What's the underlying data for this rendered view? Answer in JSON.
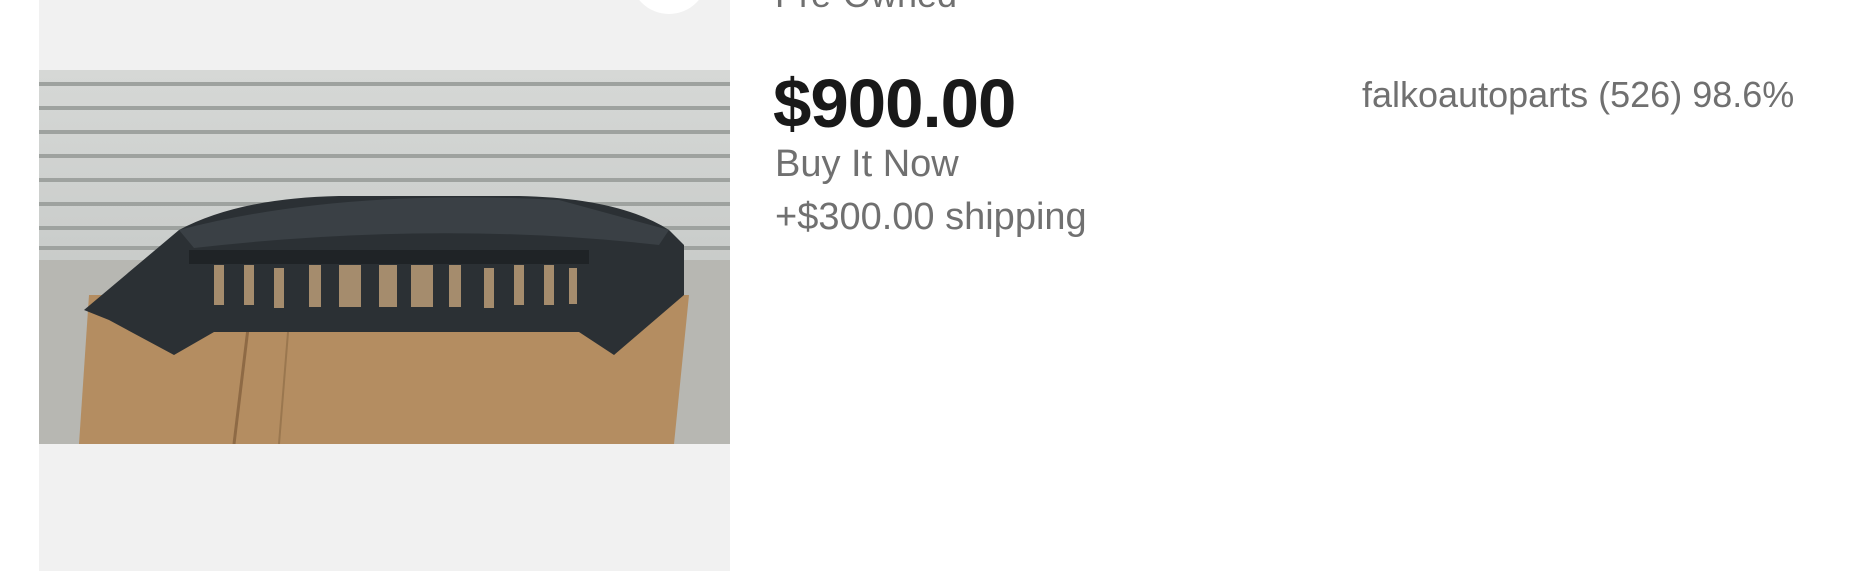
{
  "listing": {
    "condition": "Pre-Owned",
    "price": "$900.00",
    "purchase_format": "Buy It Now",
    "shipping": "+$300.00 shipping",
    "seller": "falkoautoparts (526) 98.6%"
  },
  "colors": {
    "price_text": "#191919",
    "secondary_text": "#707070",
    "image_background": "#f1f1f1"
  }
}
